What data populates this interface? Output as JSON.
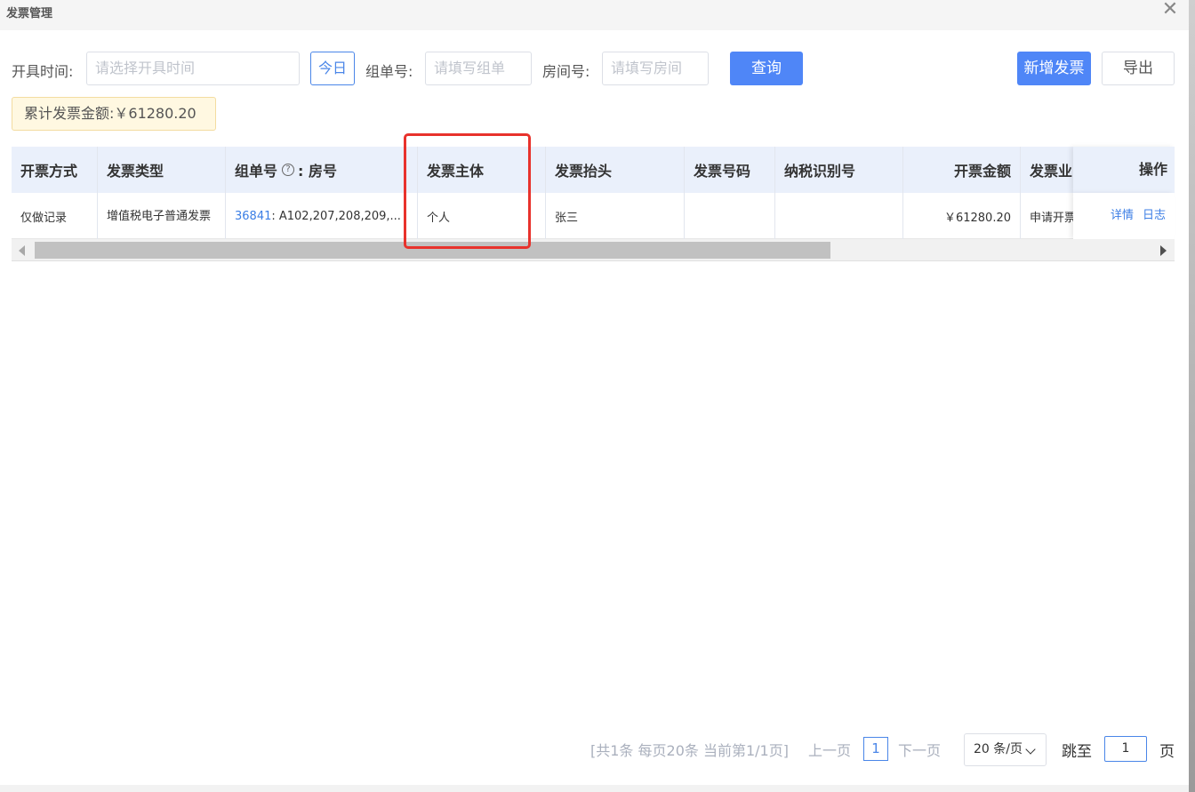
{
  "window": {
    "title": "发票管理"
  },
  "filters": {
    "issue_time_label": "开具时间:",
    "issue_time_placeholder": "请选择开具时间",
    "today_button": "今日",
    "group_no_label": "组单号:",
    "group_no_placeholder": "请填写组单",
    "room_no_label": "房间号:",
    "room_no_placeholder": "请填写房间",
    "query_button": "查询",
    "new_invoice_button": "新增发票",
    "export_button": "导出"
  },
  "summary": {
    "total_text": "累计发票金额:￥61280.20"
  },
  "table": {
    "headers": {
      "method": "开票方式",
      "type": "发票类型",
      "group_room_a": "组单号",
      "group_room_b": ": 房号",
      "subject": "发票主体",
      "header_title": "发票抬头",
      "number": "发票号码",
      "tax_id": "纳税识别号",
      "amount": "开票金额",
      "business": "发票业",
      "ops": "操作"
    },
    "rows": [
      {
        "method": "仅做记录",
        "type": "增值税电子普通发票",
        "group_no": "36841",
        "rooms": ": A102,207,208,209,...",
        "subject": "个人",
        "header_title": "张三",
        "number": "",
        "tax_id": "",
        "amount": "￥61280.20",
        "business": "申请开票",
        "op_detail": "详情",
        "op_log": "日志"
      }
    ]
  },
  "pagination": {
    "info": "[共1条 每页20条 当前第1/1页]",
    "prev": "上一页",
    "current": "1",
    "next": "下一页",
    "page_size": "20 条/页",
    "jump_label": "跳至",
    "jump_value": "1",
    "page_suffix": "页"
  },
  "colors": {
    "primary": "#4f86f7",
    "link": "#3b7ee5",
    "highlight": "#e8322c",
    "header_bg": "#eaf0fb"
  }
}
